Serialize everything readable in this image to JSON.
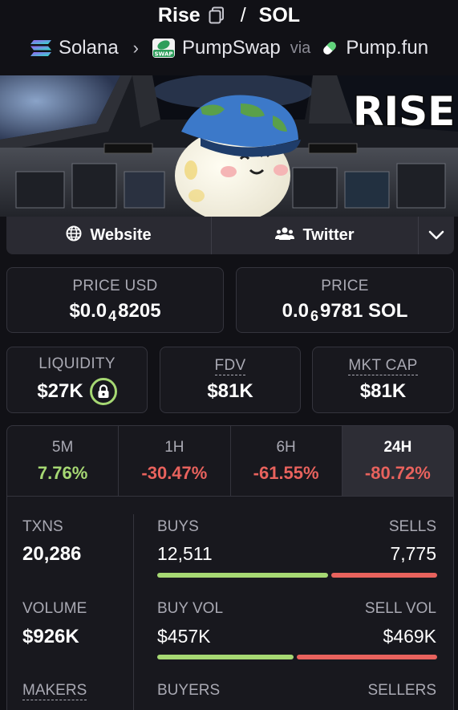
{
  "header": {
    "token_symbol": "Rise",
    "separator": "/",
    "quote_symbol": "SOL"
  },
  "chain_row": {
    "chain": "Solana",
    "dex": "PumpSwap",
    "dex_logo_text": "SWAP",
    "via": "via",
    "launchpad": "Pump.fun"
  },
  "banner": {
    "text": "RISE"
  },
  "links": {
    "website": "Website",
    "twitter": "Twitter"
  },
  "price_usd": {
    "label": "PRICE USD",
    "prefix": "$0.0",
    "zeros": "4",
    "digits": "8205"
  },
  "price_native": {
    "label": "PRICE",
    "prefix": "0.0",
    "zeros": "6",
    "digits": "9781 SOL"
  },
  "liquidity": {
    "label": "LIQUIDITY",
    "value": "$27K",
    "locked_icon": "lock-icon"
  },
  "fdv": {
    "label": "FDV",
    "value": "$81K"
  },
  "mkt_cap": {
    "label": "MKT CAP",
    "value": "$81K"
  },
  "timeframes": [
    {
      "label": "5M",
      "change": "7.76%",
      "direction": "up"
    },
    {
      "label": "1H",
      "change": "-30.47%",
      "direction": "down"
    },
    {
      "label": "6H",
      "change": "-61.55%",
      "direction": "down"
    },
    {
      "label": "24H",
      "change": "-80.72%",
      "direction": "down",
      "active": true
    }
  ],
  "stats": {
    "txns": {
      "label": "TXNS",
      "value": "20,286"
    },
    "buys": {
      "label": "BUYS",
      "value": "12,511",
      "share": 0.617
    },
    "sells": {
      "label": "SELLS",
      "value": "7,775",
      "share": 0.383
    },
    "volume": {
      "label": "VOLUME",
      "value": "$926K"
    },
    "buy_vol": {
      "label": "BUY VOL",
      "value": "$457K",
      "share": 0.494
    },
    "sell_vol": {
      "label": "SELL VOL",
      "value": "$469K",
      "share": 0.506
    },
    "makers": {
      "label": "MAKERS"
    },
    "buyers": {
      "label": "BUYERS"
    },
    "sellers": {
      "label": "SELLERS"
    }
  },
  "colors": {
    "background": "#111116",
    "positive": "#a6d873",
    "negative": "#e8625d",
    "card_border": "#34343d"
  }
}
